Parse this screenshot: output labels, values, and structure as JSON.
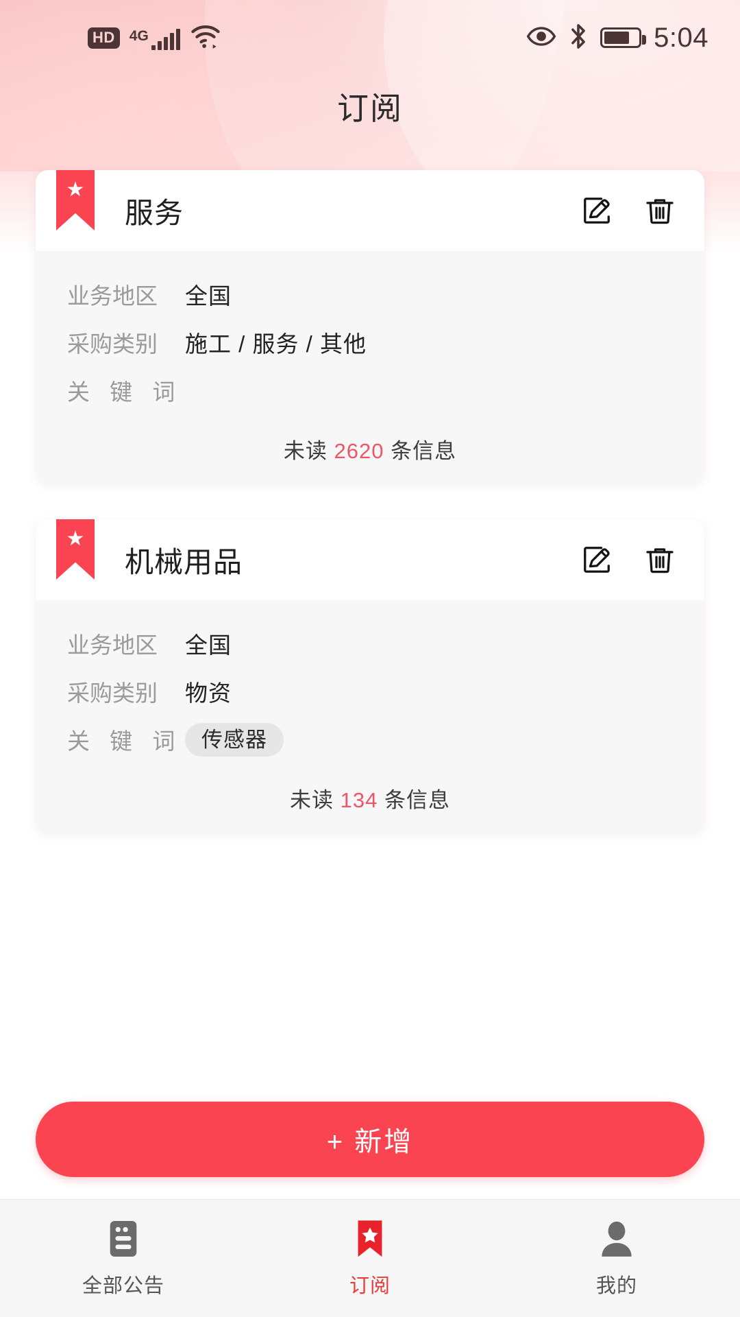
{
  "status_bar": {
    "hd_label": "HD",
    "network_label": "4G",
    "signal_icon": "signal-bars-icon",
    "wifi_icon": "wifi-icon",
    "eye_comfort_icon": "eye-icon",
    "bluetooth_icon": "bluetooth-icon",
    "battery_icon": "battery-icon",
    "time": "5:04"
  },
  "header": {
    "title": "订阅"
  },
  "subscriptions": [
    {
      "title": "服务",
      "bookmark_icon": "bookmark-star-icon",
      "edit_icon": "edit-pencil-icon",
      "delete_icon": "trash-icon",
      "rows": [
        {
          "label": "业务地区",
          "value": "全国",
          "spaced": false,
          "is_tag": false
        },
        {
          "label": "采购类别",
          "value": "施工 / 服务 / 其他",
          "spaced": false,
          "is_tag": false
        },
        {
          "label": "关 键 词",
          "value": "",
          "spaced": true,
          "is_tag": true
        }
      ],
      "unread_prefix": "未读",
      "unread_count": "2620",
      "unread_suffix": "条信息"
    },
    {
      "title": "机械用品",
      "bookmark_icon": "bookmark-star-icon",
      "edit_icon": "edit-pencil-icon",
      "delete_icon": "trash-icon",
      "rows": [
        {
          "label": "业务地区",
          "value": "全国",
          "spaced": false,
          "is_tag": false
        },
        {
          "label": "采购类别",
          "value": "物资",
          "spaced": false,
          "is_tag": false
        },
        {
          "label": "关 键 词",
          "value": "传感器",
          "spaced": true,
          "is_tag": true
        }
      ],
      "unread_prefix": "未读",
      "unread_count": "134",
      "unread_suffix": "条信息"
    }
  ],
  "add_button": {
    "label": "+ 新增",
    "color": "#fa4452"
  },
  "bottom_nav": {
    "active_color": "#ea3a3a",
    "items": [
      {
        "label": "全部公告",
        "icon": "announcement-list-icon",
        "active": false
      },
      {
        "label": "订阅",
        "icon": "bookmark-star-icon",
        "active": true
      },
      {
        "label": "我的",
        "icon": "person-icon",
        "active": false
      }
    ]
  }
}
